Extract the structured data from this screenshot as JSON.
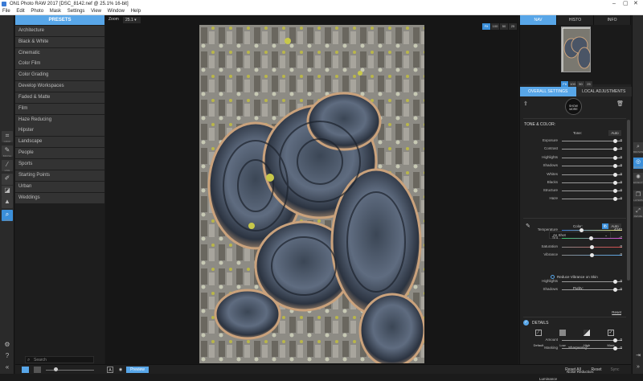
{
  "window": {
    "title": "ON1 Photo RAW 2017 [DSC_8142.nef @ 25.1% 16-bit]"
  },
  "menu": [
    "File",
    "Edit",
    "Photo",
    "Mask",
    "Settings",
    "View",
    "Window",
    "Help"
  ],
  "left_tools": [
    {
      "label": "CROP",
      "icon": "crop-icon"
    },
    {
      "label": "BRUSH",
      "icon": "brush-icon"
    },
    {
      "label": "LINE",
      "icon": "line-icon"
    },
    {
      "label": "",
      "icon": "retouch-icon"
    },
    {
      "label": "",
      "icon": "eraser-icon"
    },
    {
      "label": "",
      "icon": "stamp-icon"
    },
    {
      "label": "VIEW",
      "icon": "zoom-icon"
    }
  ],
  "presets": {
    "title": "PRESETS",
    "items": [
      "Architecture",
      "Black & White",
      "Cinematic",
      "Color Film",
      "Color Grading",
      "Develop Workspaces",
      "Faded & Matte",
      "Film",
      "Haze Reducing",
      "Hipster",
      "Landscape",
      "People",
      "Sports",
      "Starting Points",
      "Urban",
      "Weddings"
    ],
    "search_placeholder": "Search"
  },
  "canvas": {
    "zoom_label": "Zoom",
    "zoom_value": "25.1",
    "zoom_buttons": [
      "Fit",
      "100",
      "50",
      "25"
    ]
  },
  "bottom": {
    "preview": "Preview",
    "reset_all": "Reset All",
    "reset": "Reset",
    "sync": "Sync"
  },
  "right": {
    "tabs": [
      "NAV",
      "HISTO",
      "INFO"
    ],
    "nav_zoom": [
      "Fit",
      "100",
      "50",
      "25"
    ],
    "subtabs": [
      "OVERALL SETTINGS",
      "LOCAL ADJUSTMENTS"
    ],
    "show_more": "SHOW MORE",
    "tone_color": {
      "title": "TONE & COLOR:",
      "tone_label": "Tone:",
      "auto": "Auto",
      "tone": [
        {
          "name": "Exposure",
          "value": "0"
        },
        {
          "name": "Contrast",
          "value": "0"
        },
        {
          "name": "Highlights",
          "value": "0"
        },
        {
          "name": "Shadows",
          "value": "0"
        },
        {
          "name": "Whites",
          "value": "0"
        },
        {
          "name": "Blacks",
          "value": "0"
        }
      ],
      "extra": [
        {
          "name": "Structure",
          "value": "0"
        },
        {
          "name": "Haze",
          "value": "0"
        }
      ],
      "color_label": "Color:",
      "color_auto": "Auto",
      "wb_mode": "As Shot",
      "color": [
        {
          "name": "Temperature",
          "value": "4240",
          "knob": 0.32
        },
        {
          "name": "Tint",
          "value": "-7",
          "knob": 0.48
        },
        {
          "name": "Saturation",
          "value": "0",
          "knob": 0.5
        },
        {
          "name": "Vibrance",
          "value": "0",
          "knob": 0.5
        }
      ],
      "reduce_vibrance": "Reduce Vibrance on Skin",
      "purity_label": "Purity:",
      "purity": [
        {
          "name": "Highlights",
          "value": "0"
        },
        {
          "name": "Shadows",
          "value": "0"
        }
      ],
      "reset": "Reset"
    },
    "details": {
      "title": "DETAILS",
      "modes": [
        "Default",
        "Low",
        "High",
        "More"
      ],
      "sharpening_label": "Sharpening:",
      "sharpening": [
        {
          "name": "Amount",
          "value": "0"
        },
        {
          "name": "Masking",
          "value": "0"
        }
      ],
      "noise_label": "Noise Reduction:",
      "noise_first": "Luminance"
    }
  },
  "right_tools": [
    "BROWSE",
    "DEVELOP",
    "EFFECTS",
    "LAYERS",
    "RESIZE"
  ],
  "colors": {
    "accent": "#58a6e8",
    "panel": "#222222"
  }
}
